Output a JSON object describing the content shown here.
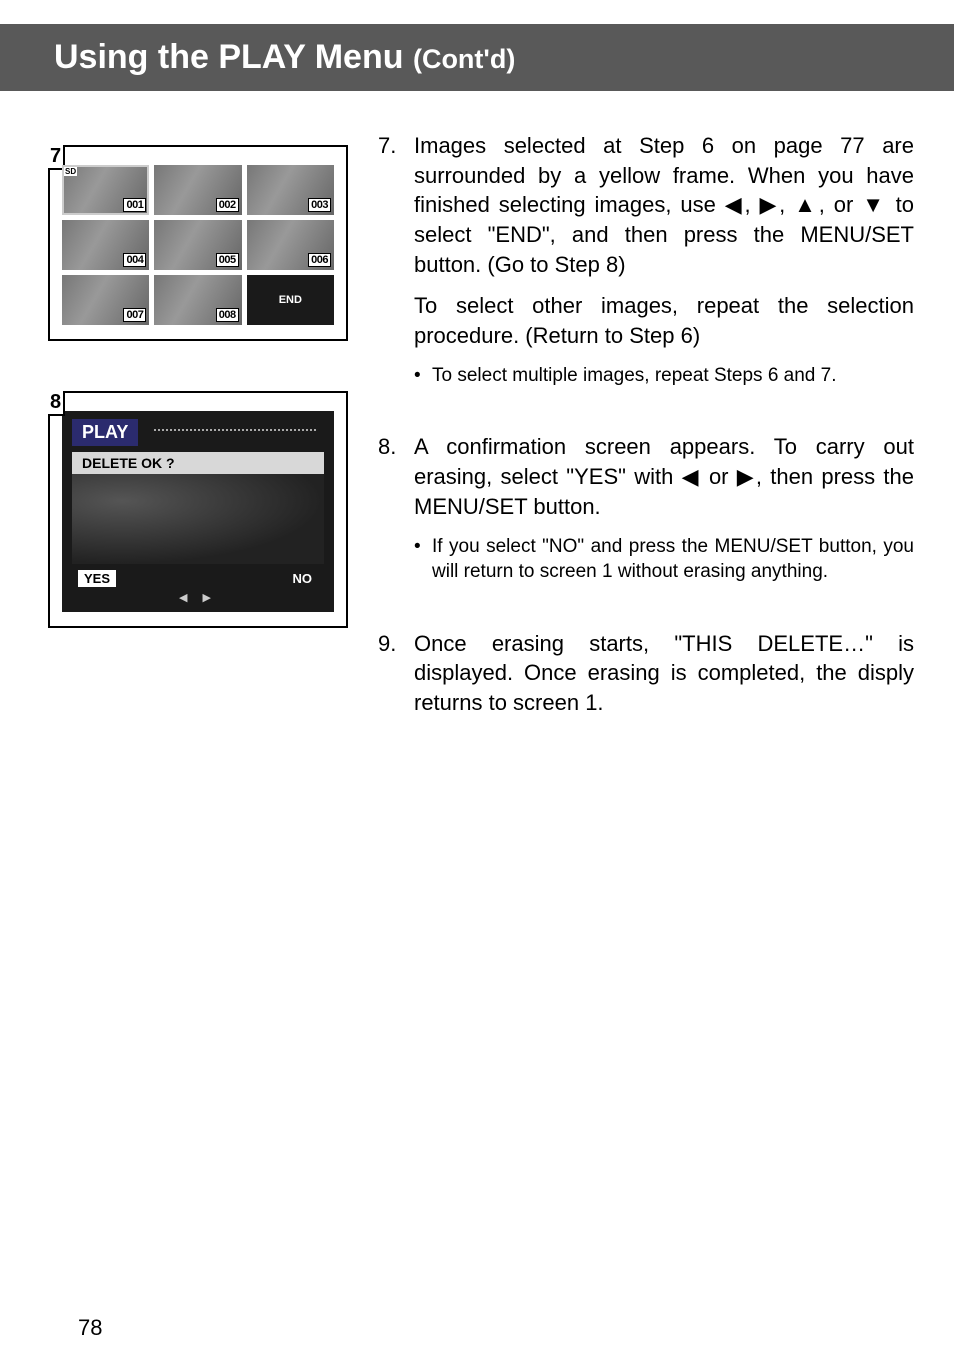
{
  "title": {
    "main": "Using the PLAY Menu",
    "sub": "(Cont'd)"
  },
  "fig7": {
    "num": "7",
    "sd": "SD",
    "thumbs": [
      "001",
      "002",
      "003",
      "004",
      "005",
      "006",
      "007",
      "008"
    ],
    "end": "END"
  },
  "fig8": {
    "num": "8",
    "header": "PLAY",
    "question": "DELETE OK ?",
    "yes": "YES",
    "no": "NO",
    "arrows": "◀  ▶"
  },
  "steps": {
    "s7": {
      "num": "7.",
      "p1_a": "Images selected at Step 6 on page 77 are surrounded by a yellow frame. When you have finished selecting images, use ",
      "arr_l": "◀",
      "c1": ", ",
      "arr_r": "▶",
      "c2": ", ",
      "arr_u": "▲",
      "c3": ", or ",
      "arr_d": "▼",
      "p1_b": " to select \"END\", and then press the MENU/SET button. (Go to Step 8)",
      "p2": "To select other images, repeat the selection procedure. (Return to Step 6)",
      "b1": "To select multiple images, repeat Steps 6 and 7."
    },
    "s8": {
      "num": "8.",
      "p1_a": "A confirmation screen appears. To carry out erasing, select \"YES\" with ",
      "arr_l": "◀",
      "or": " or ",
      "arr_r": "▶",
      "p1_b": ", then press the MENU/SET button.",
      "b1": "If you select \"NO\" and press the MENU/SET button, you will return to screen 1 without erasing anything."
    },
    "s9": {
      "num": "9.",
      "p1": "Once erasing starts, \"THIS DELETE…\" is displayed. Once erasing is completed, the disply returns to screen 1."
    }
  },
  "pagenum": "78"
}
